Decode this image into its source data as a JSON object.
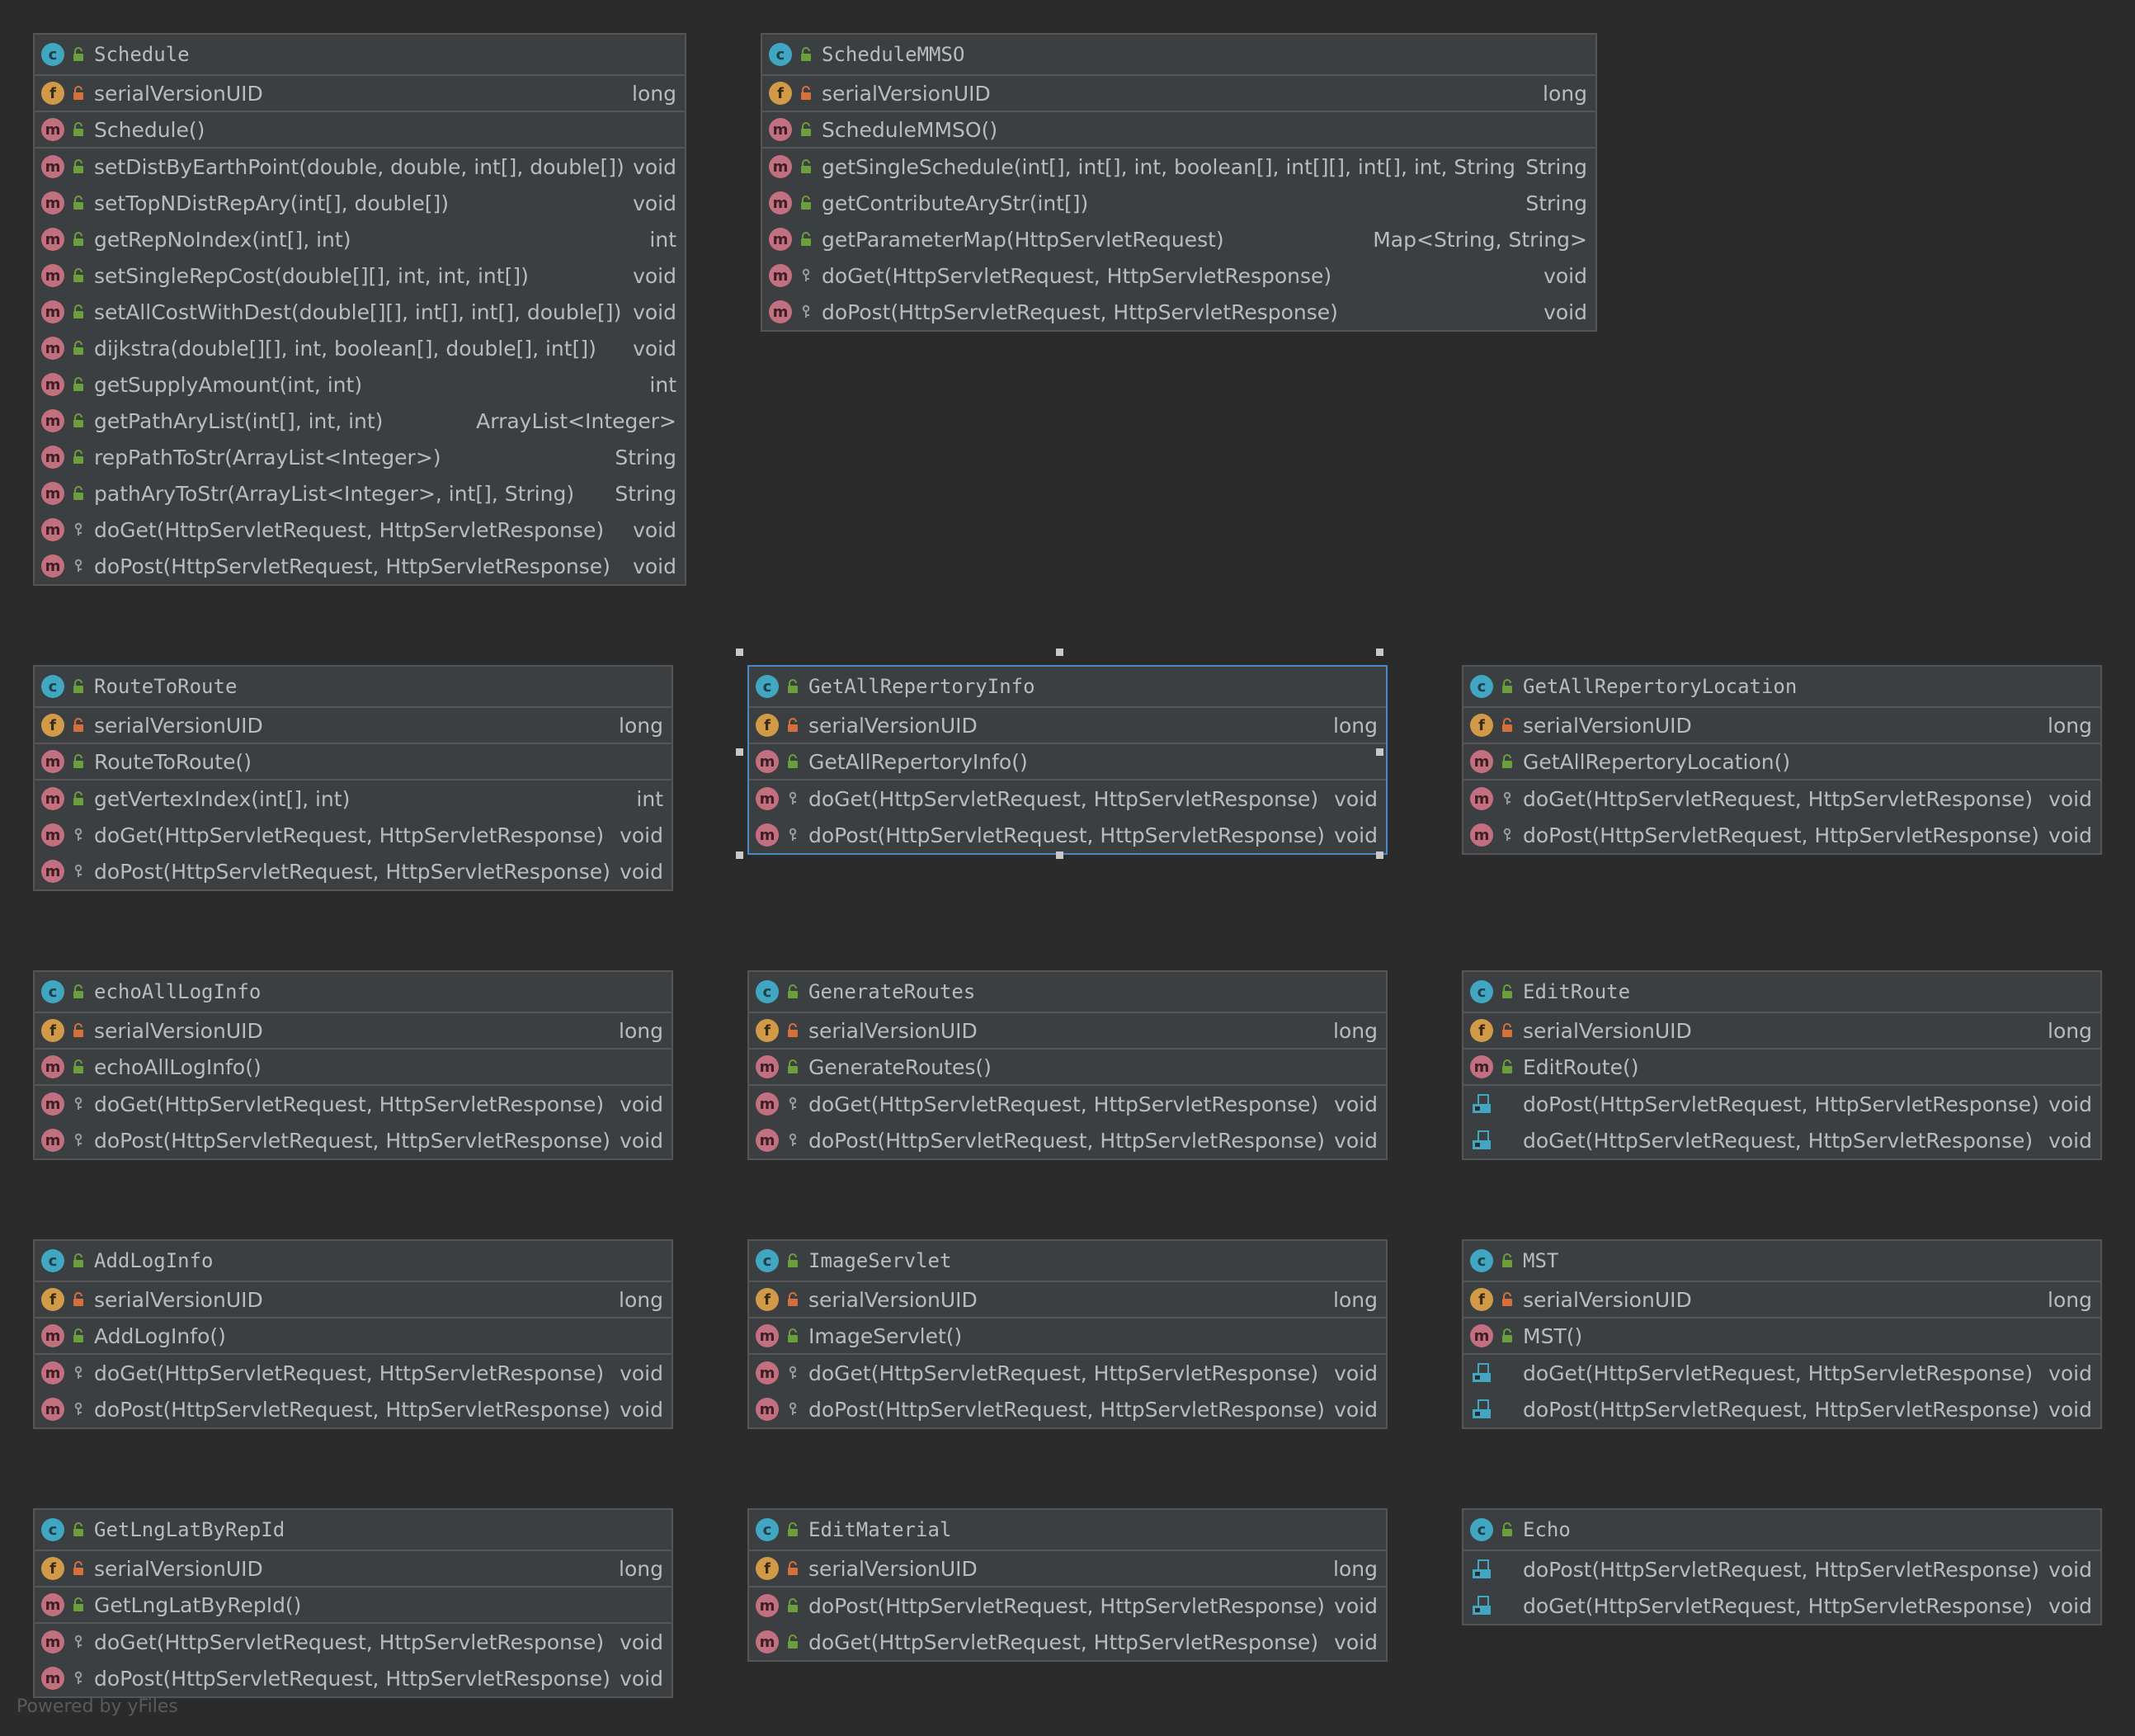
{
  "footer": "Powered by yFiles",
  "colors": {
    "background": "#2b2b2b",
    "node_fill": "#3c3f41",
    "node_border": "#555555",
    "selected_border": "#4a88c7",
    "class_icon": "#40a6c2",
    "field_icon": "#d19a48",
    "method_icon": "#c27080",
    "public_lock": "#6a9f3c",
    "private_lock": "#d4703c"
  },
  "classes": [
    {
      "name": "Schedule",
      "rows": [
        {
          "kind": "field",
          "vis": "private",
          "name": "serialVersionUID",
          "type": "long",
          "sep": true
        },
        {
          "kind": "method",
          "vis": "public",
          "name": "Schedule()",
          "type": "",
          "sep": true
        },
        {
          "kind": "method-static",
          "vis": "public",
          "name": "setDistByEarthPoint(double, double, int[], double[])",
          "type": "void"
        },
        {
          "kind": "method-static",
          "vis": "public",
          "name": "setTopNDistRepAry(int[], double[])",
          "type": "void"
        },
        {
          "kind": "method-static",
          "vis": "public",
          "name": "getRepNoIndex(int[], int)",
          "type": "int"
        },
        {
          "kind": "method-static",
          "vis": "public",
          "name": "setSingleRepCost(double[][], int, int, int[])",
          "type": "void"
        },
        {
          "kind": "method-static",
          "vis": "public",
          "name": "setAllCostWithDest(double[][], int[], int[], double[])",
          "type": "void"
        },
        {
          "kind": "method-static",
          "vis": "public",
          "name": "dijkstra(double[][], int, boolean[], double[], int[])",
          "type": "void"
        },
        {
          "kind": "method-static",
          "vis": "public",
          "name": "getSupplyAmount(int, int)",
          "type": "int"
        },
        {
          "kind": "method-static",
          "vis": "public",
          "name": "getPathAryList(int[], int, int)",
          "type": "ArrayList<Integer>"
        },
        {
          "kind": "method-static",
          "vis": "public",
          "name": "repPathToStr(ArrayList<Integer>)",
          "type": "String"
        },
        {
          "kind": "method-static",
          "vis": "public",
          "name": "pathAryToStr(ArrayList<Integer>, int[], String)",
          "type": "String"
        },
        {
          "kind": "method",
          "vis": "protected",
          "name": "doGet(HttpServletRequest, HttpServletResponse)",
          "type": "void"
        },
        {
          "kind": "method",
          "vis": "protected",
          "name": "doPost(HttpServletRequest, HttpServletResponse)",
          "type": "void"
        }
      ]
    },
    {
      "name": "ScheduleMMSO",
      "rows": [
        {
          "kind": "field",
          "vis": "private",
          "name": "serialVersionUID",
          "type": "long",
          "sep": true
        },
        {
          "kind": "method",
          "vis": "public",
          "name": "ScheduleMMSO()",
          "type": "",
          "sep": true
        },
        {
          "kind": "method-static",
          "vis": "public",
          "name": "getSingleSchedule(int[], int[], int, boolean[], int[][], int[], int, String)",
          "type": "String"
        },
        {
          "kind": "method-static",
          "vis": "public",
          "name": "getContributeAryStr(int[])",
          "type": "String"
        },
        {
          "kind": "method-static",
          "vis": "public",
          "name": "getParameterMap(HttpServletRequest)",
          "type": "Map<String, String>"
        },
        {
          "kind": "method",
          "vis": "protected",
          "name": "doGet(HttpServletRequest, HttpServletResponse)",
          "type": "void"
        },
        {
          "kind": "method",
          "vis": "protected",
          "name": "doPost(HttpServletRequest, HttpServletResponse)",
          "type": "void"
        }
      ]
    },
    {
      "name": "RouteToRoute",
      "rows": [
        {
          "kind": "field",
          "vis": "private",
          "name": "serialVersionUID",
          "type": "long",
          "sep": true
        },
        {
          "kind": "method",
          "vis": "public",
          "name": "RouteToRoute()",
          "type": "",
          "sep": true
        },
        {
          "kind": "method",
          "vis": "public",
          "name": "getVertexIndex(int[], int)",
          "type": "int"
        },
        {
          "kind": "method",
          "vis": "protected",
          "name": "doGet(HttpServletRequest, HttpServletResponse)",
          "type": "void"
        },
        {
          "kind": "method",
          "vis": "protected",
          "name": "doPost(HttpServletRequest, HttpServletResponse)",
          "type": "void"
        }
      ]
    },
    {
      "name": "GetAllRepertoryInfo",
      "selected": true,
      "rows": [
        {
          "kind": "field",
          "vis": "private",
          "name": "serialVersionUID",
          "type": "long",
          "sep": true
        },
        {
          "kind": "method",
          "vis": "public",
          "name": "GetAllRepertoryInfo()",
          "type": "",
          "sep": true
        },
        {
          "kind": "method",
          "vis": "protected",
          "name": "doGet(HttpServletRequest, HttpServletResponse)",
          "type": "void"
        },
        {
          "kind": "method",
          "vis": "protected",
          "name": "doPost(HttpServletRequest, HttpServletResponse)",
          "type": "void"
        }
      ]
    },
    {
      "name": "GetAllRepertoryLocation",
      "rows": [
        {
          "kind": "field",
          "vis": "private",
          "name": "serialVersionUID",
          "type": "long",
          "sep": true
        },
        {
          "kind": "method",
          "vis": "public",
          "name": "GetAllRepertoryLocation()",
          "type": "",
          "sep": true
        },
        {
          "kind": "method",
          "vis": "protected",
          "name": "doGet(HttpServletRequest, HttpServletResponse)",
          "type": "void"
        },
        {
          "kind": "method",
          "vis": "protected",
          "name": "doPost(HttpServletRequest, HttpServletResponse)",
          "type": "void"
        }
      ]
    },
    {
      "name": "echoAllLogInfo",
      "rows": [
        {
          "kind": "field",
          "vis": "private",
          "name": "serialVersionUID",
          "type": "long",
          "sep": true
        },
        {
          "kind": "method",
          "vis": "public",
          "name": "echoAllLogInfo()",
          "type": "",
          "sep": true
        },
        {
          "kind": "method",
          "vis": "protected",
          "name": "doGet(HttpServletRequest, HttpServletResponse)",
          "type": "void"
        },
        {
          "kind": "method",
          "vis": "protected",
          "name": "doPost(HttpServletRequest, HttpServletResponse)",
          "type": "void"
        }
      ]
    },
    {
      "name": "GenerateRoutes",
      "rows": [
        {
          "kind": "field",
          "vis": "private",
          "name": "serialVersionUID",
          "type": "long",
          "sep": true
        },
        {
          "kind": "method",
          "vis": "public",
          "name": "GenerateRoutes()",
          "type": "",
          "sep": true
        },
        {
          "kind": "method",
          "vis": "protected",
          "name": "doGet(HttpServletRequest, HttpServletResponse)",
          "type": "void"
        },
        {
          "kind": "method",
          "vis": "protected",
          "name": "doPost(HttpServletRequest, HttpServletResponse)",
          "type": "void"
        }
      ]
    },
    {
      "name": "EditRoute",
      "rows": [
        {
          "kind": "field",
          "vis": "private",
          "name": "serialVersionUID",
          "type": "long",
          "sep": true
        },
        {
          "kind": "method",
          "vis": "public",
          "name": "EditRoute()",
          "type": "",
          "sep": true
        },
        {
          "kind": "method-override",
          "vis": "none",
          "name": "doPost(HttpServletRequest, HttpServletResponse)",
          "type": "void"
        },
        {
          "kind": "method-override",
          "vis": "none",
          "name": "doGet(HttpServletRequest, HttpServletResponse)",
          "type": "void"
        }
      ]
    },
    {
      "name": "AddLogInfo",
      "rows": [
        {
          "kind": "field",
          "vis": "private",
          "name": "serialVersionUID",
          "type": "long",
          "sep": true
        },
        {
          "kind": "method",
          "vis": "public",
          "name": "AddLogInfo()",
          "type": "",
          "sep": true
        },
        {
          "kind": "method",
          "vis": "protected",
          "name": "doGet(HttpServletRequest, HttpServletResponse)",
          "type": "void"
        },
        {
          "kind": "method",
          "vis": "protected",
          "name": "doPost(HttpServletRequest, HttpServletResponse)",
          "type": "void"
        }
      ]
    },
    {
      "name": "ImageServlet",
      "rows": [
        {
          "kind": "field",
          "vis": "private",
          "name": "serialVersionUID",
          "type": "long",
          "sep": true
        },
        {
          "kind": "method",
          "vis": "public",
          "name": "ImageServlet()",
          "type": "",
          "sep": true
        },
        {
          "kind": "method",
          "vis": "protected",
          "name": "doGet(HttpServletRequest, HttpServletResponse)",
          "type": "void"
        },
        {
          "kind": "method",
          "vis": "protected",
          "name": "doPost(HttpServletRequest, HttpServletResponse)",
          "type": "void"
        }
      ]
    },
    {
      "name": "MST",
      "rows": [
        {
          "kind": "field",
          "vis": "private",
          "name": "serialVersionUID",
          "type": "long",
          "sep": true
        },
        {
          "kind": "method",
          "vis": "public",
          "name": "MST()",
          "type": "",
          "sep": true
        },
        {
          "kind": "method-override",
          "vis": "none",
          "name": "doGet(HttpServletRequest, HttpServletResponse)",
          "type": "void"
        },
        {
          "kind": "method-override",
          "vis": "none",
          "name": "doPost(HttpServletRequest, HttpServletResponse)",
          "type": "void"
        }
      ]
    },
    {
      "name": "GetLngLatByRepId",
      "rows": [
        {
          "kind": "field",
          "vis": "private",
          "name": "serialVersionUID",
          "type": "long",
          "sep": true
        },
        {
          "kind": "method",
          "vis": "public",
          "name": "GetLngLatByRepId()",
          "type": "",
          "sep": true
        },
        {
          "kind": "method",
          "vis": "protected",
          "name": "doGet(HttpServletRequest, HttpServletResponse)",
          "type": "void"
        },
        {
          "kind": "method",
          "vis": "protected",
          "name": "doPost(HttpServletRequest, HttpServletResponse)",
          "type": "void"
        }
      ]
    },
    {
      "name": "EditMaterial",
      "rows": [
        {
          "kind": "field",
          "vis": "private",
          "name": "serialVersionUID",
          "type": "long",
          "sep": true
        },
        {
          "kind": "method",
          "vis": "public",
          "name": "doPost(HttpServletRequest, HttpServletResponse)",
          "type": "void"
        },
        {
          "kind": "method",
          "vis": "public",
          "name": "doGet(HttpServletRequest, HttpServletResponse)",
          "type": "void"
        }
      ]
    },
    {
      "name": "Echo",
      "rows": [
        {
          "kind": "method-override",
          "vis": "none",
          "name": "doPost(HttpServletRequest, HttpServletResponse)",
          "type": "void"
        },
        {
          "kind": "method-override",
          "vis": "none",
          "name": "doGet(HttpServletRequest, HttpServletResponse)",
          "type": "void"
        }
      ]
    }
  ]
}
